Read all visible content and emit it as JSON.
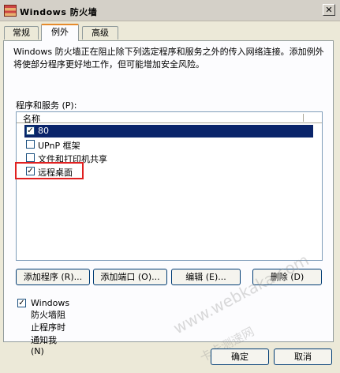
{
  "window": {
    "title": "Windows 防火墙",
    "close_symbol": "✕"
  },
  "tabs": [
    {
      "label": "常规"
    },
    {
      "label": "例外"
    },
    {
      "label": "高级"
    }
  ],
  "description": "Windows 防火墙正在阻止除下列选定程序和服务之外的传入网络连接。添加例外将使部分程序更好地工作，但可能增加安全风险。",
  "programs_label": "程序和服务 (P):",
  "list": {
    "header": "名称",
    "items": [
      {
        "label": "80",
        "checked": true
      },
      {
        "label": "UPnP 框架",
        "checked": false
      },
      {
        "label": "文件和打印机共享",
        "checked": false
      },
      {
        "label": "远程桌面",
        "checked": true
      }
    ]
  },
  "buttons": {
    "add_program": "添加程序 (R)...",
    "add_port": "添加端口 (O)...",
    "edit": "编辑 (E)...",
    "delete": "删除 (D)",
    "ok": "确定",
    "cancel": "取消"
  },
  "notify": {
    "label": "Windows 防火墙阻止程序时通知我 (N)",
    "checked": true
  },
  "checkmark": "✓",
  "watermark": {
    "text1": "www.webkaka.com",
    "text2": "卡卡测速网"
  },
  "colors": {
    "selected_row": "#0a246a",
    "highlight_box": "#e02020"
  }
}
